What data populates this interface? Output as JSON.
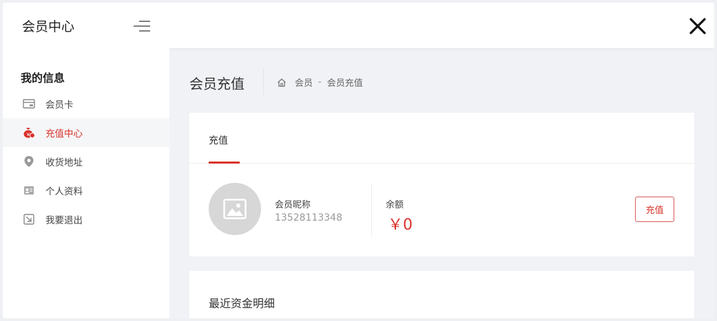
{
  "header": {
    "title": "会员中心"
  },
  "sidebar": {
    "heading": "我的信息",
    "items": [
      {
        "label": "会员卡",
        "icon": "card-icon",
        "active": false
      },
      {
        "label": "充值中心",
        "icon": "money-bag-icon",
        "active": true
      },
      {
        "label": "收货地址",
        "icon": "location-pin-icon",
        "active": false
      },
      {
        "label": "个人资料",
        "icon": "id-card-icon",
        "active": false
      },
      {
        "label": "我要退出",
        "icon": "logout-icon",
        "active": false
      }
    ]
  },
  "main": {
    "page_title": "会员充值",
    "breadcrumb": {
      "root": "会员",
      "separator": "-",
      "current": "会员充值"
    },
    "tabs": [
      {
        "label": "充值",
        "active": true
      }
    ],
    "member": {
      "nick_label": "会员昵称",
      "phone": "13528113348",
      "balance_label": "余额",
      "balance_value": "￥0"
    },
    "recharge_button": "充值",
    "recent_title": "最近资金明细"
  },
  "colors": {
    "accent": "#d9332a",
    "background": "#f0f2f5"
  }
}
